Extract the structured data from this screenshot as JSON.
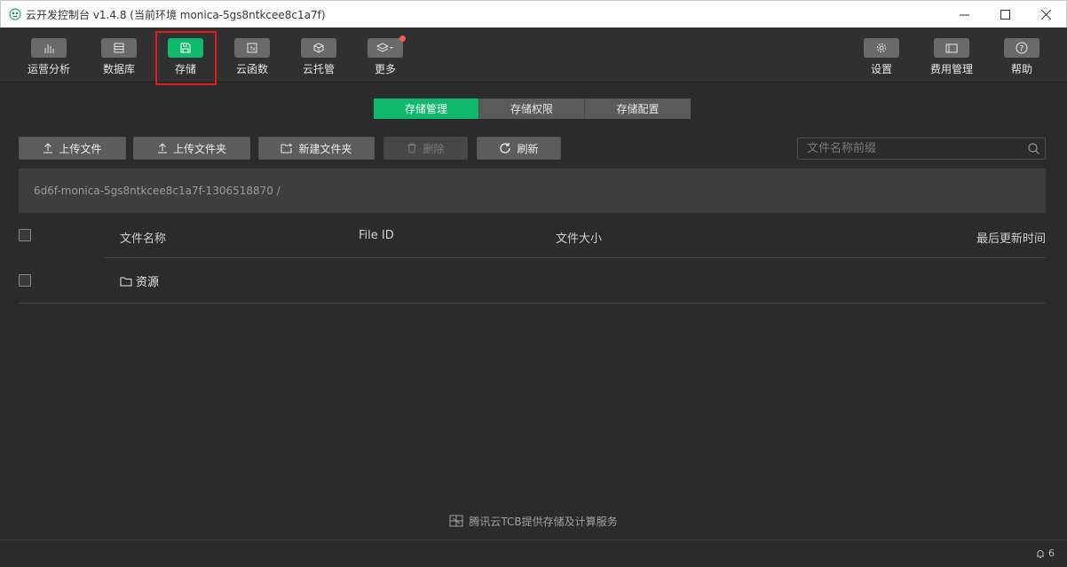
{
  "window": {
    "title": "云开发控制台 v1.4.8 (当前环境 monica-5gs8ntkcee8c1a7f)",
    "controls": [
      "minimize-icon",
      "maximize-icon",
      "close-icon"
    ]
  },
  "toolbar": {
    "items": [
      {
        "label": "运营分析",
        "icon": "bar-chart-icon"
      },
      {
        "label": "数据库",
        "icon": "database-icon"
      },
      {
        "label": "存储",
        "icon": "floppy-disk-icon",
        "active": true
      },
      {
        "label": "云函数",
        "icon": "function-icon"
      },
      {
        "label": "云托管",
        "icon": "cube-icon"
      },
      {
        "label": "更多",
        "icon": "layers-icon"
      },
      {
        "label": "设置",
        "icon": "gear-icon"
      },
      {
        "label": "费用管理",
        "icon": "wallet-icon"
      },
      {
        "label": "帮助",
        "icon": "help-icon"
      }
    ]
  },
  "tabs": [
    {
      "label": "存储管理",
      "active": true
    },
    {
      "label": "存储权限"
    },
    {
      "label": "存储配置"
    }
  ],
  "actions": {
    "upload_file": "上传文件",
    "upload_folder": "上传文件夹",
    "new_folder": "新建文件夹",
    "delete": "删除",
    "refresh": "刷新"
  },
  "search": {
    "placeholder": "文件名称前缀",
    "value": ""
  },
  "path": "6d6f-monica-5gs8ntkcee8c1a7f-1306518870 /",
  "table": {
    "columns": [
      "文件名称",
      "File ID",
      "文件大小",
      "最后更新时间"
    ],
    "rows": [
      {
        "name": "资源",
        "type": "folder",
        "file_id": "",
        "size": "",
        "updated": ""
      }
    ]
  },
  "footer": {
    "text": "腾讯云TCB提供存储及计算服务"
  },
  "status": {
    "notification_count": "6"
  },
  "colors": {
    "accent": "#0fb86b",
    "highlight": "#e11b1b",
    "background": "#2b2b2b"
  }
}
